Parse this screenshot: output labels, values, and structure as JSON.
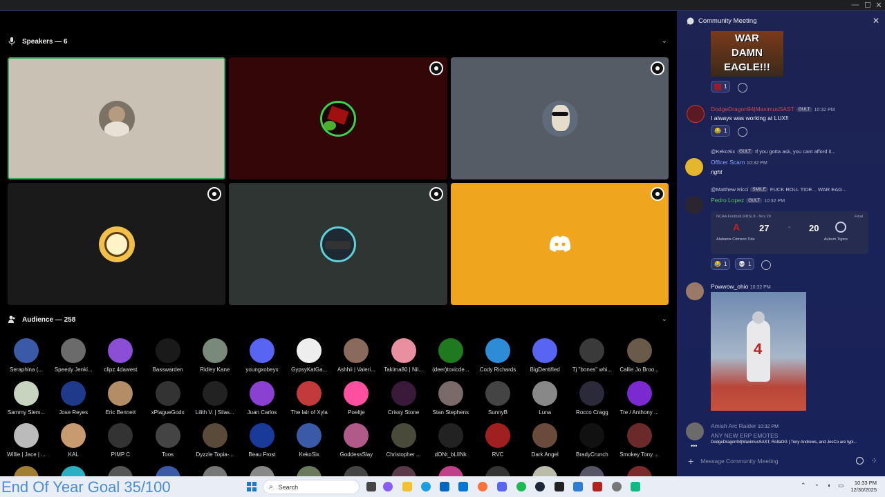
{
  "window": {
    "minimize": "—",
    "maximize": "☐",
    "close": "✕"
  },
  "speakers": {
    "header": "Speakers — 6"
  },
  "audience": {
    "header": "Audience — 258",
    "members": [
      [
        "Seraphina (...",
        "Speedy Jenki...",
        "clipz.4dawest",
        "Basswarden",
        "Ridley Kane",
        "youngxobeyx",
        "GypsyKatGa...",
        "Ashhii | Valeri...",
        "Takima80 | Nil...",
        "(deer)toxicde...",
        "Cody Richards",
        "BigDentified",
        "Tj \"bones\" whi...",
        "Callie Jo Broo..."
      ],
      [
        "Sammy Siem...",
        "Jose Reyes",
        "Eric Bennett",
        "xPlagueGodx",
        "Lilith V. | Silas...",
        "Juan Carlos",
        "The lair of Xyla",
        "Poeltje",
        "Crissy Stone",
        "Stan Stephens",
        "SunnyB",
        "Luna",
        "Rocco Cragg",
        "Tre / Anthony ..."
      ],
      [
        "Willie | Jace | ...",
        "KAL",
        "PIMP C",
        "Toos",
        "Dyzzle Topia-...",
        "Beau Frost",
        "KekoSix",
        "GoddessSlay",
        "Christopher ...",
        "dONt_bLIINk",
        "RVC",
        "Dark Angel",
        "BradyCrunch",
        "Smokey Tony ..."
      ]
    ]
  },
  "chat": {
    "title": "Community Meeting",
    "gif_text": "WAR\nDAMN\nEAGLE!!!",
    "react1_count": "1",
    "msg1": {
      "user": "DodgeDragon94|MaximusSAST",
      "tag": "GULT",
      "time": "10:32 PM",
      "text": "I always was working at LUX!!",
      "react_count": "1"
    },
    "msg2": {
      "reply_user": "@KekoSix",
      "reply_tag": "GULT",
      "reply_text": "If you gotta ask, you cant afford it...",
      "user": "Officer Scarn",
      "time": "10:32 PM",
      "text": "right"
    },
    "msg3": {
      "reply_user": "@Matthew Ricci",
      "reply_tag": "SMILE",
      "reply_text": "FUCK ROLL TIDE... WAR EAG...",
      "user": "Pedro Lopez",
      "tag": "GULT",
      "time": "10:32 PM",
      "score": {
        "league": "NCAA Football (FBS) 8 · Nov 29",
        "status": "Final",
        "home_score": "27",
        "dash": "-",
        "away_score": "20",
        "home_team": "Alabama Crimson Tide",
        "away_team": "Auburn Tigers"
      },
      "react_a": "1",
      "react_b": "1"
    },
    "msg4": {
      "user": "Powwow_ohio",
      "time": "10:32 PM"
    },
    "msg5": {
      "user": "Amish Arc Raider",
      "time": "10:32 PM",
      "text": "ANY NEW ERP EMOTES"
    },
    "typing": "DodgeDragon94|MaximusSAST, RollaOG | Tony Andrews, and JesCo are typi...",
    "input_placeholder": "Message Community Meeting"
  },
  "taskbar": {
    "goal": "End Of Year Goal 35/100",
    "search": "Search",
    "time": "10:33 PM",
    "date": "12/30/2025"
  }
}
